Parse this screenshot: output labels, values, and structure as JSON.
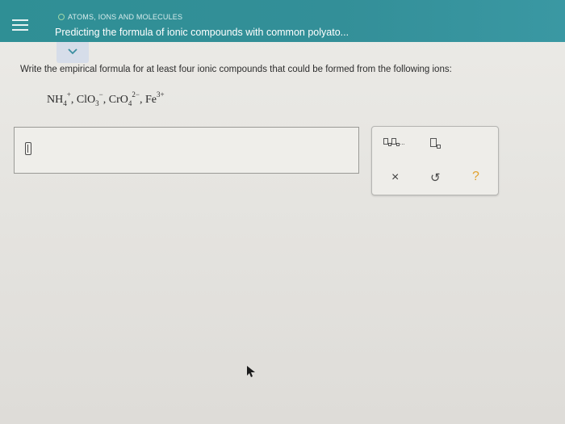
{
  "header": {
    "topic": "ATOMS, IONS AND MOLECULES",
    "title": "Predicting the formula of ionic compounds with common polyato..."
  },
  "question": {
    "prompt": "Write the empirical formula for at least four ionic compounds that could be formed from the following ions:",
    "ions": [
      {
        "base": "NH",
        "sub": "4",
        "sup": "+"
      },
      {
        "base": "ClO",
        "sub": "3",
        "sup": "−"
      },
      {
        "base": "CrO",
        "sub": "4",
        "sup": "2−"
      },
      {
        "base": "Fe",
        "sub": "",
        "sup": "3+"
      }
    ],
    "separator": ", "
  },
  "toolbox": {
    "subscript_label": "□,□,...",
    "help_label": "?",
    "clear_label": "×",
    "undo_label": "↺"
  },
  "colors": {
    "header": "#338f98",
    "help": "#e2a12c"
  },
  "icons": [
    "menu-icon",
    "chevron-down-icon",
    "text-cursor-icon",
    "close-icon",
    "undo-icon",
    "help-icon",
    "pointer-cursor-icon"
  ]
}
